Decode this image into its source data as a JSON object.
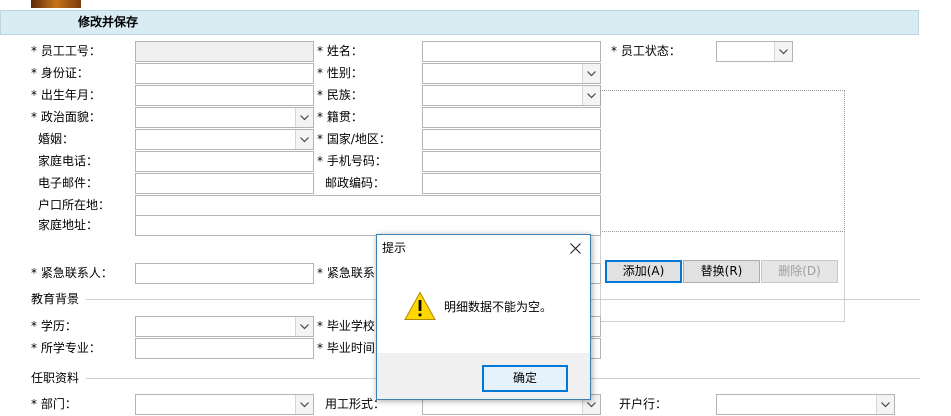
{
  "section_bar": {
    "title": "修改并保存"
  },
  "form": {
    "emp_no": "* 员工工号：",
    "name": "* 姓名：",
    "emp_status": "* 员工状态：",
    "id_card": "* 身份证：",
    "gender": "* 性别：",
    "birth": "* 出生年月：",
    "ethnic": "* 民族：",
    "politics": "* 政治面貌：",
    "native": "* 籍贯：",
    "marriage": "婚姻：",
    "country": "* 国家/地区：",
    "home_phone": "家庭电话：",
    "mobile": "* 手机号码：",
    "email": "电子邮件：",
    "postcode": "邮政编码：",
    "hukou": "户口所在地：",
    "address": "家庭地址：",
    "emergency_contact": "* 紧急联系人：",
    "emergency_contact2": "* 紧急联系",
    "edu_group": "教育背景",
    "degree": "* 学历：",
    "school": "* 毕业学校",
    "major": "* 所学专业：",
    "grad_time": "* 毕业时间",
    "job_group": "任职资料",
    "dept": "* 部门：",
    "emp_form": "用工形式：",
    "bank": "开户行："
  },
  "buttons": {
    "add": "添加(A)",
    "replace": "替换(R)",
    "delete": "删除(D)"
  },
  "dialog": {
    "title": "提示",
    "message": "明细数据不能为空。",
    "ok": "确定"
  }
}
